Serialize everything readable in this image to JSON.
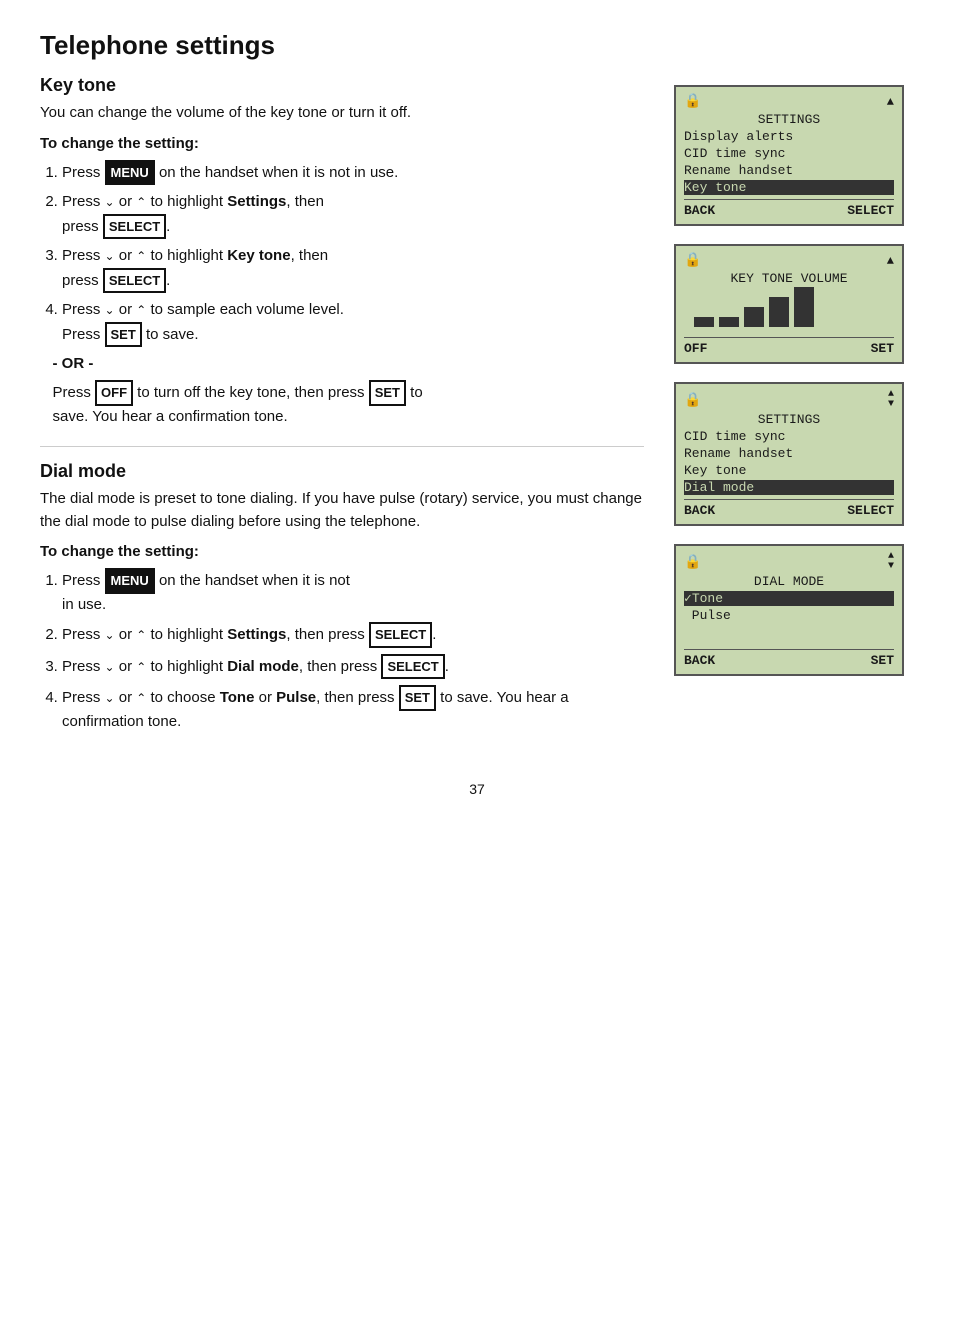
{
  "page": {
    "title": "Telephone settings",
    "page_number": "37"
  },
  "key_tone_section": {
    "title": "Key tone",
    "description": "You can change the volume of the key tone or turn it off.",
    "to_change_label": "To change the setting:",
    "steps": [
      "Press <MENU> on the handset when it is not in use.",
      "Press ↓ or ↑ to highlight <b>Settings</b>, then press <SELECT>.",
      "Press ↓ or ↑ to highlight <b>Key tone</b>, then press <SELECT>.",
      "Press ↓ or ↑ to sample each volume level. Press <SET> to save."
    ],
    "or_label": "- OR -",
    "or_text": "Press <OFF> to turn off the key tone, then press <SET> to save. You hear a confirmation tone."
  },
  "dial_mode_section": {
    "title": "Dial mode",
    "description": "The dial mode is preset to tone dialing. If you have pulse (rotary) service, you must change the dial mode to pulse dialing before using the telephone.",
    "to_change_label": "To change the setting:",
    "steps": [
      "Press <MENU> on the handset when it is not in use.",
      "Press ↓ or ↑ to highlight <b>Settings</b>, then press <SELECT>.",
      "Press ↓ or ↑ to highlight <b>Dial mode</b>, then press <SELECT>.",
      "Press ↓ or ↑ to choose <b>Tone</b> or <b>Pulse</b>, then press <SET> to save. You hear a confirmation tone."
    ]
  },
  "screens": {
    "settings_menu_keytone": {
      "header": "SETTINGS",
      "rows": [
        "Display alerts",
        "CID time sync",
        "Rename handset",
        "Key tone"
      ],
      "highlighted": "Key tone",
      "footer_left": "BACK",
      "footer_right": "SELECT"
    },
    "key_tone_volume": {
      "header": "KEY TONE VOLUME",
      "footer_left": "OFF",
      "footer_right": "SET"
    },
    "settings_menu_dialmode": {
      "header": "SETTINGS",
      "rows": [
        "CID time sync",
        "Rename handset",
        "Key tone",
        "Dial mode"
      ],
      "highlighted": "Dial mode",
      "footer_left": "BACK",
      "footer_right": "SELECT"
    },
    "dial_mode_select": {
      "header": "DIAL MODE",
      "rows": [
        "Tone",
        "Pulse"
      ],
      "highlighted": "Tone",
      "footer_left": "BACK",
      "footer_right": "SET"
    }
  }
}
